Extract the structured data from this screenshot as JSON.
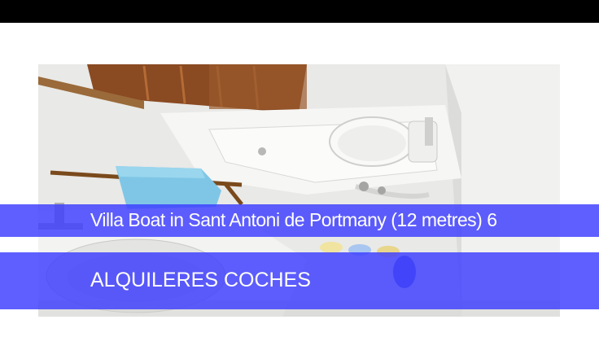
{
  "photo": {
    "subject": "boat bathroom with toilet and sink"
  },
  "title_banner": {
    "text": "Villa Boat in Sant Antoni de Portmany (12 metres) 6"
  },
  "sub_banner": {
    "text": "ALQUILERES COCHES"
  },
  "colors": {
    "top_bar": "#000000",
    "banner": "#3c3cff",
    "banner_text": "#ffffff"
  }
}
